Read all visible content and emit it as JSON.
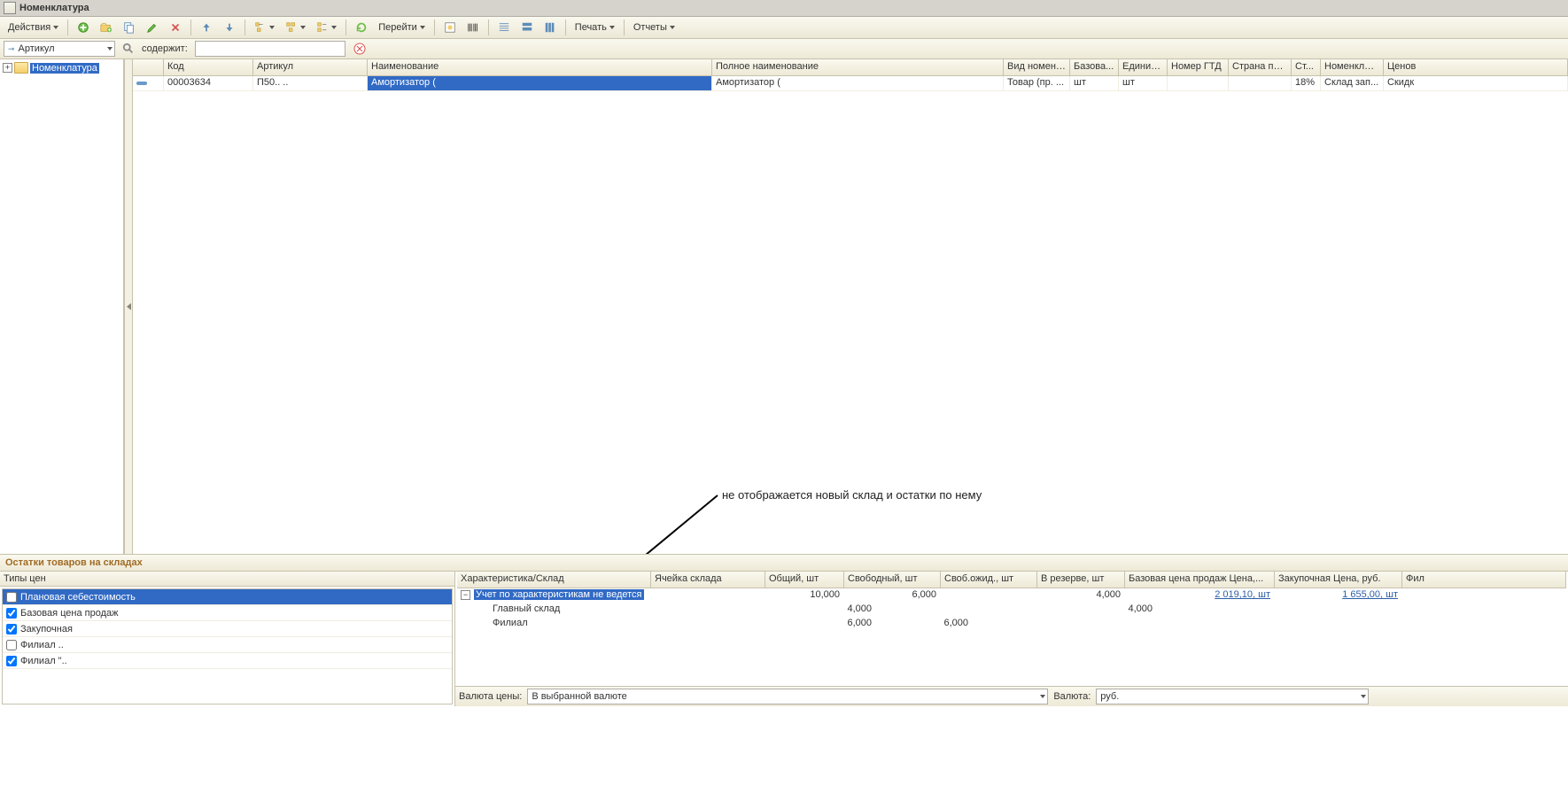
{
  "window": {
    "title": "Номенклатура"
  },
  "toolbar": {
    "actions": "Действия",
    "goto": "Перейти",
    "print": "Печать",
    "reports": "Отчеты"
  },
  "filter": {
    "field": "Артикул",
    "label": "содержит:",
    "value": ""
  },
  "tree": {
    "root": "Номенклатура"
  },
  "grid": {
    "headers": {
      "marker": "",
      "code": "Код",
      "article": "Артикул",
      "name": "Наименование",
      "full_name": "Полное наименование",
      "nomencl_type": "Вид номенк...",
      "base": "Базова...",
      "unit": "Единиц...",
      "gtd": "Номер ГТД",
      "country": "Страна про...",
      "rate": "Ст...",
      "nomencl": "Номенклат...",
      "price": "Ценов"
    },
    "row": {
      "code": "00003634",
      "article": "П50.. ..",
      "name": "Амортизатор (",
      "full_name": "Амортизатор (",
      "nomencl_type": "Товар (пр. ...",
      "base": "шт",
      "unit": "шт",
      "gtd": "",
      "country": "",
      "rate": "18%",
      "nomencl": "Склад зап...",
      "price": "Скидк"
    }
  },
  "annotation": {
    "text": "не отображается новый склад  и остатки по нему"
  },
  "section": {
    "title": "Остатки товаров на складах"
  },
  "price_types": {
    "header": "Типы цен",
    "rows": [
      {
        "label": "Плановая себестоимость",
        "checked": false,
        "selected": true
      },
      {
        "label": "Базовая цена продаж",
        "checked": true,
        "selected": false
      },
      {
        "label": "Закупочная",
        "checked": true,
        "selected": false
      },
      {
        "label": "Филиал ..",
        "checked": false,
        "selected": false
      },
      {
        "label": "Филиал \"..",
        "checked": true,
        "selected": false
      }
    ]
  },
  "stock": {
    "headers": {
      "char": "Характеристика/Склад",
      "cell": "Ячейка склада",
      "total": "Общий, шт",
      "free": "Свободный, шт",
      "free_exp": "Своб.ожид., шт",
      "reserve": "В резерве, шт",
      "base_price": "Базовая цена продаж Цена,...",
      "purchase_price": "Закупочная Цена, руб.",
      "fil": "Фил"
    },
    "rows": [
      {
        "type": "group",
        "char": "Учет по характеристикам не ведется",
        "cell": "",
        "total": "10,000",
        "free": "6,000",
        "free_exp": "",
        "reserve": "4,000",
        "base_price": "2 019,10, шт",
        "purchase_price": "1 655,00, шт",
        "selected": true
      },
      {
        "type": "child",
        "char": "Главный склад",
        "cell": "",
        "total": "4,000",
        "free": "",
        "free_exp": "",
        "reserve": "4,000",
        "base_price": "",
        "purchase_price": ""
      },
      {
        "type": "child",
        "char": "Филиал",
        "cell": "",
        "total": "6,000",
        "free": "6,000",
        "free_exp": "",
        "reserve": "",
        "base_price": "",
        "purchase_price": ""
      }
    ]
  },
  "footer": {
    "currency_price_label": "Валюта цены:",
    "currency_price_value": "В выбранной валюте",
    "currency_label": "Валюта:",
    "currency_value": "руб."
  }
}
